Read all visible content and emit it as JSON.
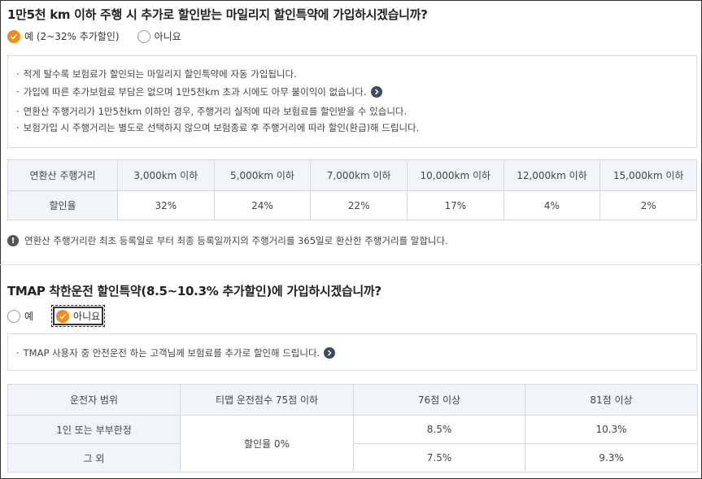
{
  "q1": {
    "title": "1만5천 km 이하 주행 시 추가로 할인받는 마일리지 할인특약에 가입하시겠습니까?",
    "option_yes": "예 (2~32% 추가할인)",
    "option_no": "아니요",
    "notes": [
      "적게 탈수록 보험료가 할인되는 마일리지 할인특약에 자동 가입됩니다.",
      "가입에 따른 추가보험료 부담은 없으며 1만5천km 초과 시에도 아무 불이익이 없습니다.",
      "연환산 주행거리가 1만5천km 이하인 경우, 주행거리 실적에 따라 보험료를 할인받을 수 있습니다.",
      "보험가입 시 주행거리는 별도로 선택하지 않으며 보험종료 후 주행거리에 따라 할인(환급)해 드립니다."
    ],
    "table": {
      "row1_label": "연환산 주행거리",
      "row2_label": "할인율",
      "distances": [
        "3,000km 이하",
        "5,000km 이하",
        "7,000km 이하",
        "10,000km 이하",
        "12,000km 이하",
        "15,000km 이하"
      ],
      "rates": [
        "32%",
        "24%",
        "22%",
        "17%",
        "4%",
        "2%"
      ]
    },
    "info": "연환산 주행거리란 최초 등록일로 부터 최종 등록일까지의 주행거리를 365일로 환산한 주행거리를 말합니다."
  },
  "q2": {
    "title": "TMAP 착한운전 할인특약(8.5~10.3% 추가할인)에 가입하시겠습니까?",
    "option_yes": "예",
    "option_no": "아니요",
    "note": "TMAP 사용자 중 안전운전 하는 고객님께 보험료를 추가로 할인해 드립니다.",
    "table": {
      "headers": [
        "운전자 범위",
        "티맵 운전점수 75점 이하",
        "76점 이상",
        "81점 이상"
      ],
      "rows": [
        {
          "label": "1인 또는 부부한정",
          "v76": "8.5%",
          "v81": "10.3%"
        },
        {
          "label": "그 외",
          "v76": "7.5%",
          "v81": "9.3%"
        }
      ],
      "merged": "할인율 0%"
    }
  },
  "colors": {
    "accent": "#f28c1b",
    "icon_dark": "#3d4b63",
    "table_head": "#f1f4f8"
  }
}
